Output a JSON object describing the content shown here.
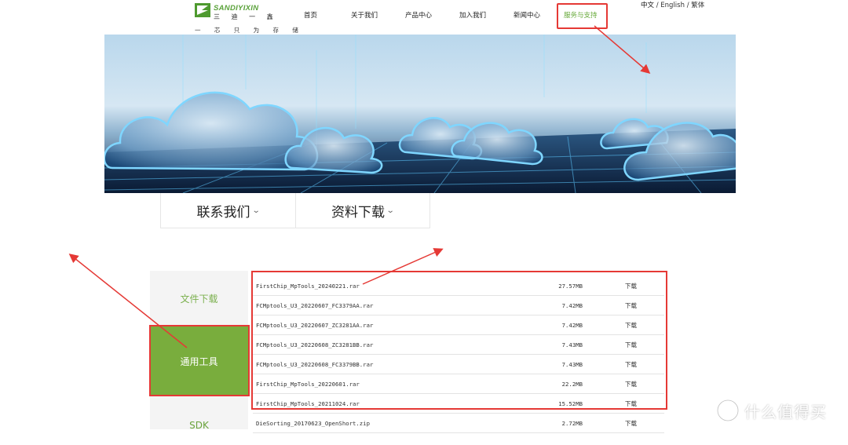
{
  "brand": {
    "logo_en": "SANDIYIXIN",
    "logo_cn": "三 迪 一 鑫",
    "slogan": "一 芯 只 为 存 储",
    "accent": "#6aab3e"
  },
  "nav": {
    "items": [
      {
        "label": "首页"
      },
      {
        "label": "关于我们"
      },
      {
        "label": "产品中心"
      },
      {
        "label": "加入我们"
      },
      {
        "label": "新闻中心"
      },
      {
        "label": "服务与支持",
        "active": true
      }
    ]
  },
  "lang": {
    "zh": "中文",
    "en": "English",
    "tw": "繁体",
    "sep": "/"
  },
  "section_tabs": [
    {
      "label": "联系我们"
    },
    {
      "label": "资料下载"
    }
  ],
  "sidebar": {
    "items": [
      {
        "label": "文件下载"
      },
      {
        "label": "通用工具",
        "active": true
      },
      {
        "label": "SDK"
      }
    ]
  },
  "files": [
    {
      "name": "FirstChip_MpTools_20240221.rar",
      "size": "27.57MB",
      "action": "下载"
    },
    {
      "name": "FCMptools_U3_20220607_FC3379AA.rar",
      "size": "7.42MB",
      "action": "下载"
    },
    {
      "name": "FCMptools_U3_20220607_ZC3281AA.rar",
      "size": "7.42MB",
      "action": "下载"
    },
    {
      "name": "FCMptools_U3_20220608_ZC3281BB.rar",
      "size": "7.43MB",
      "action": "下载"
    },
    {
      "name": "FCMptools_U3_20220608_FC3379BB.rar",
      "size": "7.43MB",
      "action": "下载"
    },
    {
      "name": "FirstChip_MpTools_20220601.rar",
      "size": "22.2MB",
      "action": "下载"
    },
    {
      "name": "FirstChip_MpTools_20211024.rar",
      "size": "15.52MB",
      "action": "下载"
    },
    {
      "name": "DieSorting_20170623_OpenShort.zip",
      "size": "2.72MB",
      "action": "下载"
    }
  ],
  "watermark": {
    "text": "什么值得买",
    "icon": "zhi-logo-icon"
  },
  "colors": {
    "annotation": "#e53935",
    "active_bg": "#79ad3d"
  }
}
